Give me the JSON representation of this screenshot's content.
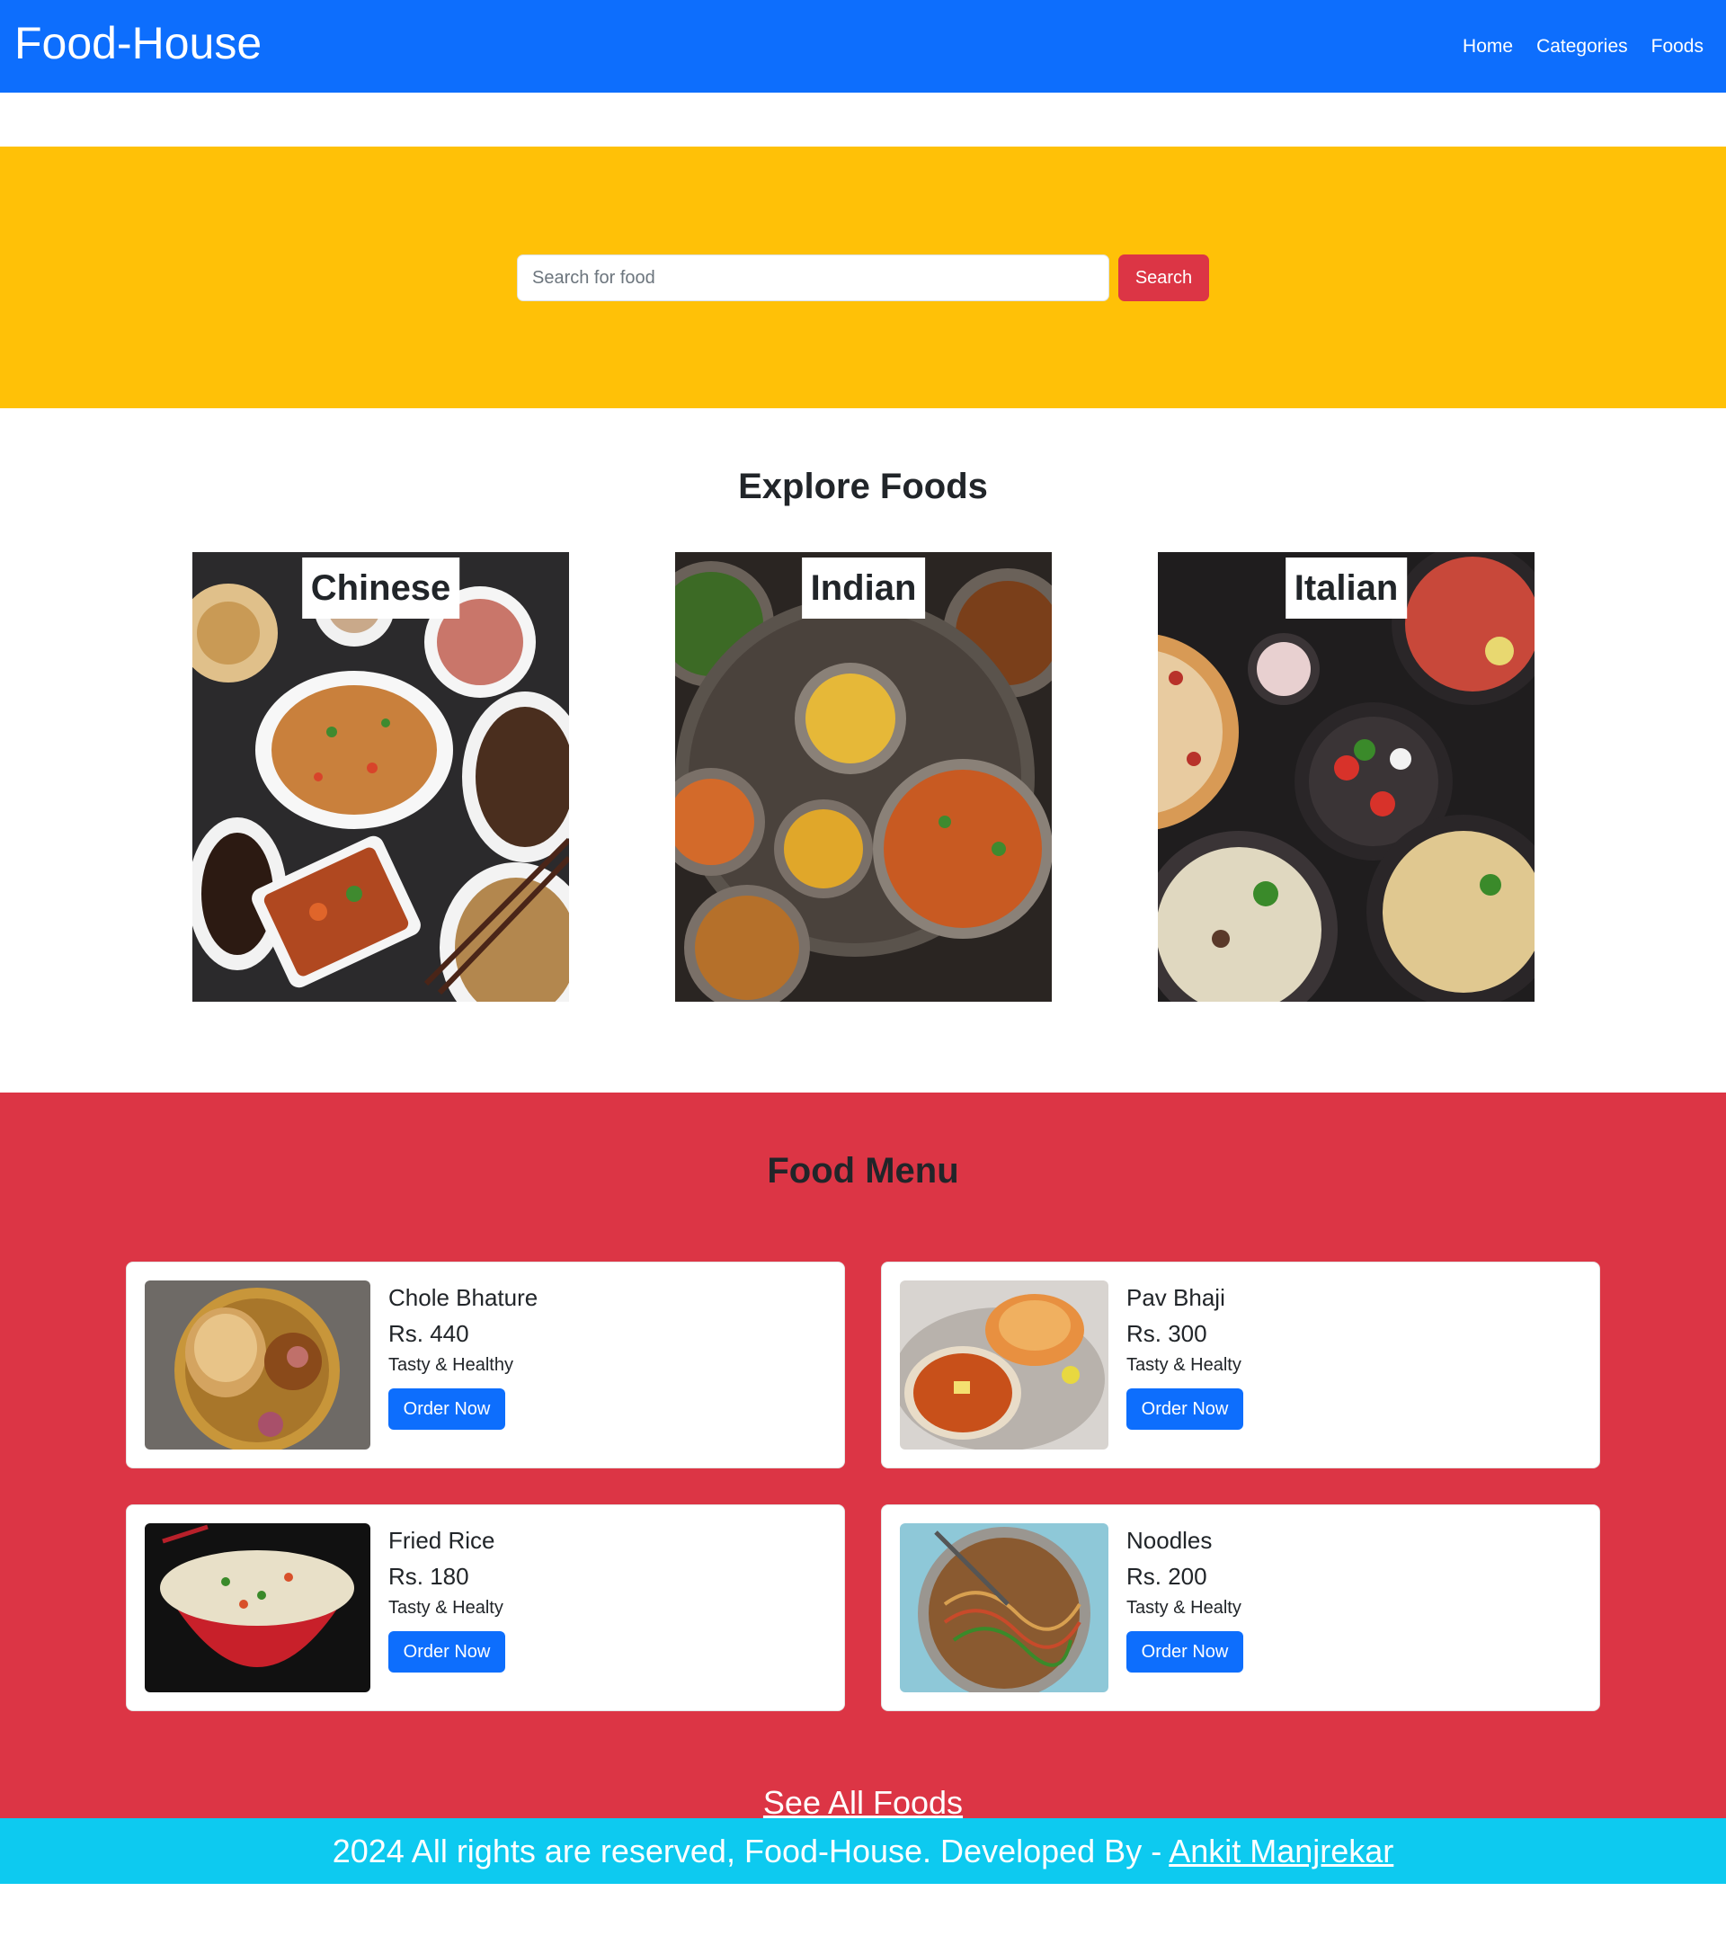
{
  "navbar": {
    "brand": "Food-House",
    "links": [
      "Home",
      "Categories",
      "Foods"
    ],
    "color": "#0d6efd"
  },
  "hero": {
    "search_placeholder": "Search for food",
    "search_button": "Search",
    "color": "#ffc107"
  },
  "explore": {
    "title": "Explore Foods",
    "categories": [
      "Chinese",
      "Indian",
      "Italian"
    ]
  },
  "menu": {
    "title": "Food Menu",
    "items": [
      {
        "name": "Chole Bhature",
        "price": "Rs. 440",
        "desc": "Tasty & Healthy",
        "button": "Order Now"
      },
      {
        "name": "Pav Bhaji",
        "price": "Rs. 300",
        "desc": "Tasty & Healty",
        "button": "Order Now"
      },
      {
        "name": "Fried Rice",
        "price": "Rs. 180",
        "desc": "Tasty & Healty",
        "button": "Order Now"
      },
      {
        "name": "Noodles",
        "price": "Rs. 200",
        "desc": "Tasty & Healty",
        "button": "Order Now"
      }
    ],
    "see_all": "See All Foods",
    "color": "#dc3545"
  },
  "footer": {
    "text": "2024 All rights are reserved, Food-House. Developed By - ",
    "author": "Ankit Manjrekar",
    "color": "#0dcaf0"
  }
}
